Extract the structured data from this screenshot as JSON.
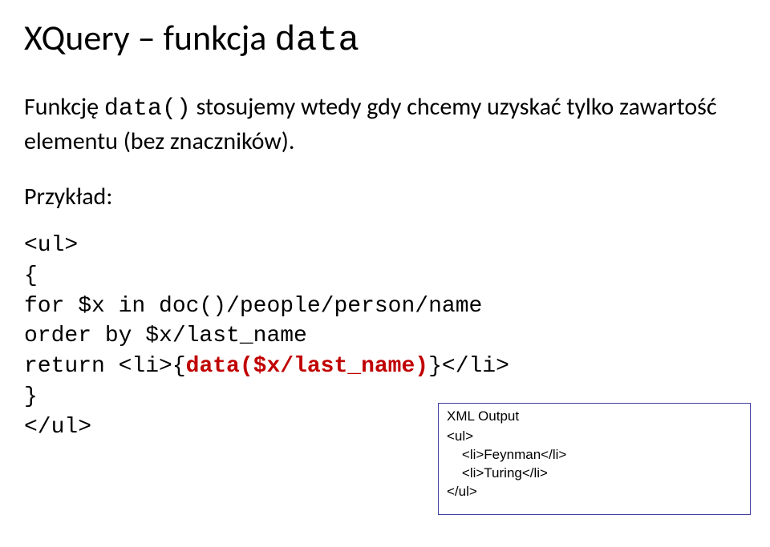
{
  "title": {
    "pre": "XQuery – funkcja ",
    "code": "data"
  },
  "paragraph": {
    "pre": "Funkcję ",
    "code": "data()",
    "post": " stosujemy wtedy gdy chcemy uzyskać tylko zawartość elementu (bez znaczników)."
  },
  "example_label": "Przykład:",
  "code": {
    "l1": "<ul>",
    "l2": "{",
    "l3": "for $x in doc()/people/person/name",
    "l4": "order by $x/last_name",
    "l5_pre": "return <li>{",
    "l5_bold": "data($x/last_name)",
    "l5_post": "}</li>",
    "l6": "}",
    "l7": "</ul>"
  },
  "output": {
    "title": "XML Output",
    "l1": "<ul>",
    "l2": "    <li>Feynman</li>",
    "l3": "    <li>Turing</li>",
    "l4": "</ul>"
  }
}
